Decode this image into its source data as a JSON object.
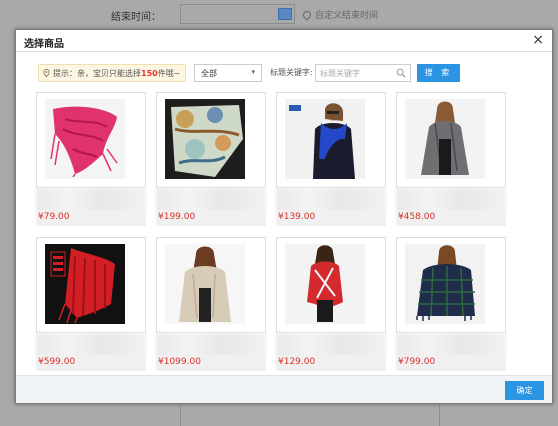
{
  "background": {
    "end_time_label": "结束时间：",
    "custom_end_time": "自定义结束时间"
  },
  "modal": {
    "title": "选择商品",
    "close_label": "×",
    "tip_prefix": "提示：亲，宝贝只能选择",
    "tip_number": "150",
    "tip_suffix": "件哦~",
    "category_select": "全部",
    "keyword_label": "标题关键字:",
    "keyword_placeholder": "标题关键字",
    "search_button": "搜 索",
    "confirm_button": "确定"
  },
  "products": [
    {
      "price": "¥79.00",
      "scarf": "pink"
    },
    {
      "price": "¥199.00",
      "scarf": "silk-print"
    },
    {
      "price": "¥139.00",
      "scarf": "blue"
    },
    {
      "price": "¥458.00",
      "scarf": "grey"
    },
    {
      "price": "¥599.00",
      "scarf": "red-fringe"
    },
    {
      "price": "¥1099.00",
      "scarf": "beige"
    },
    {
      "price": "¥129.00",
      "scarf": "red-white"
    },
    {
      "price": "¥799.00",
      "scarf": "navy-plaid"
    }
  ],
  "colors": {
    "accent": "#2b95e3",
    "price": "#d9322b"
  }
}
